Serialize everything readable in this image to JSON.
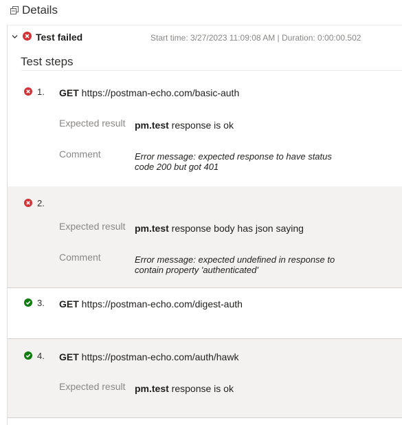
{
  "header": {
    "title": "Details",
    "icon": "restore-window-icon"
  },
  "summary": {
    "status": "Test failed",
    "meta": "Start time: 3/27/2023 11:09:08 AM | Duration: 0:00:00.502"
  },
  "section_title": "Test steps",
  "labels": {
    "expected": "Expected result",
    "comment": "Comment"
  },
  "colors": {
    "fail": "#d13438",
    "pass": "#107c10",
    "alt_row": "#f3f2f1"
  },
  "steps": [
    {
      "number": "1.",
      "status": "failed",
      "method": "GET",
      "url": "https://postman-echo.com/basic-auth",
      "expected_kw": "pm.test",
      "expected_text": " response is ok",
      "comment": "Error message: expected response to have status code 200 but got 401"
    },
    {
      "number": "2.",
      "status": "failed",
      "method": "",
      "url": "",
      "expected_kw": "pm.test",
      "expected_text": " response body has json saying",
      "comment": "Error message: expected undefined in response to contain property 'authenticated'"
    },
    {
      "number": "3.",
      "status": "passed",
      "method": "GET",
      "url": "https://postman-echo.com/digest-auth"
    },
    {
      "number": "4.",
      "status": "passed",
      "method": "GET",
      "url": "https://postman-echo.com/auth/hawk",
      "expected_kw": "pm.test",
      "expected_text": " response is ok"
    }
  ]
}
